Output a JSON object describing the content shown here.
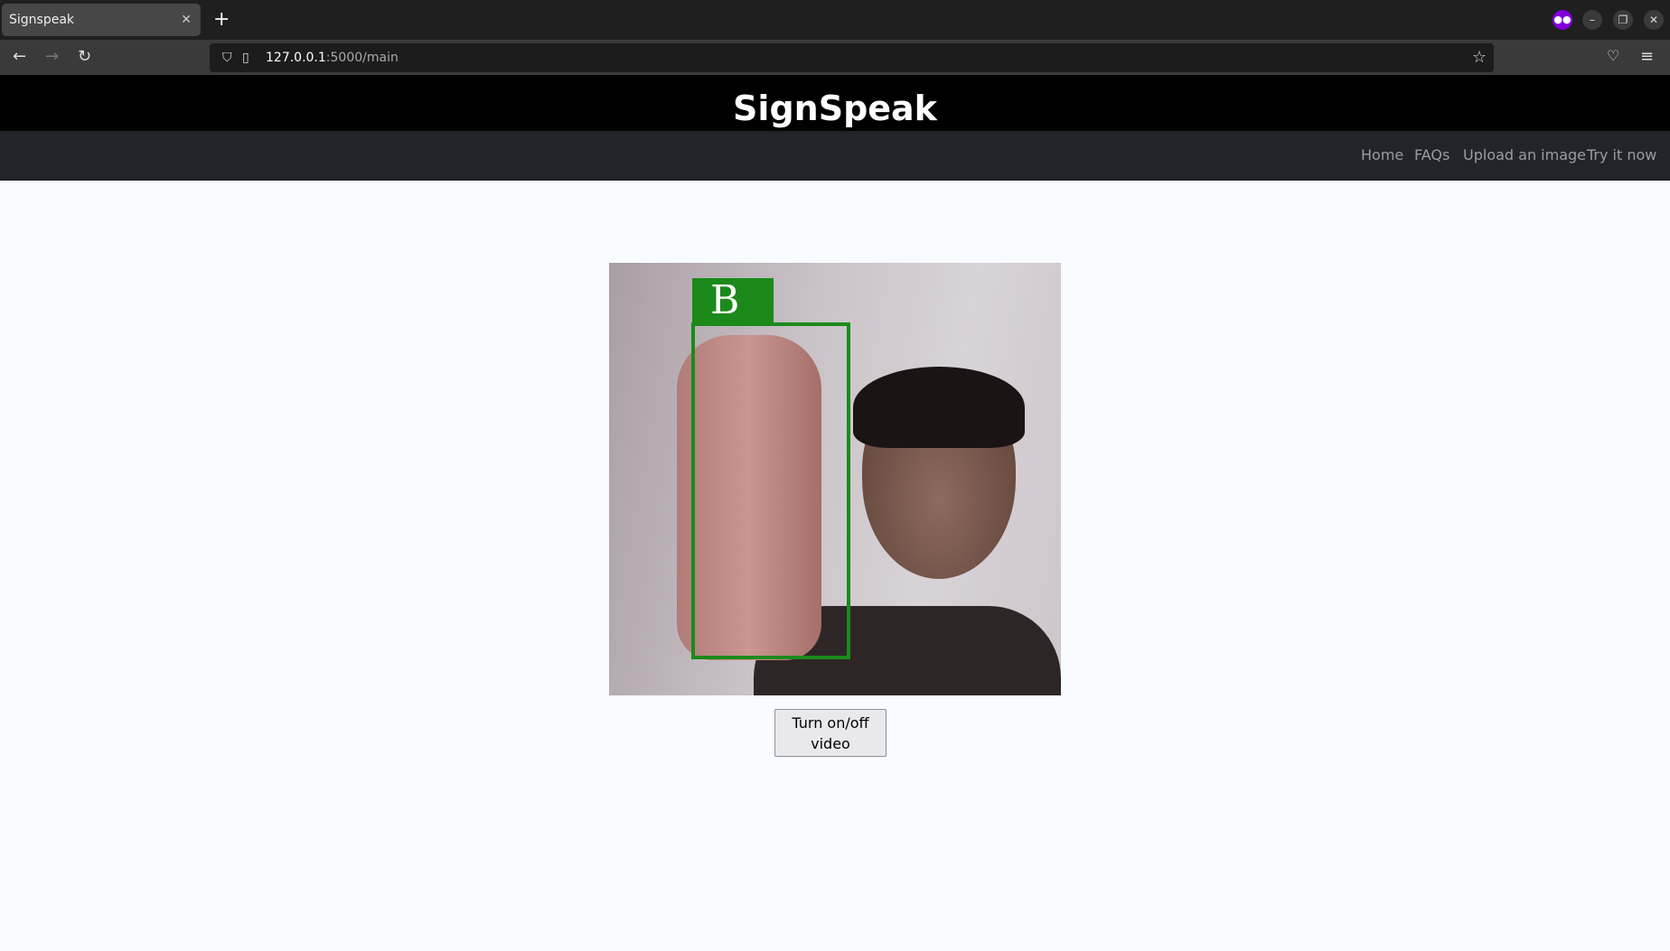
{
  "browser": {
    "tab_title": "Signspeak",
    "url_host": "127.0.0.1",
    "url_rest": ":5000/main"
  },
  "header": {
    "title": "SignSpeak"
  },
  "nav": {
    "items": [
      "Home",
      "FAQs",
      "Upload an image",
      "Try it now"
    ]
  },
  "video": {
    "detected_label": "B",
    "box_color": "#1b8a1b"
  },
  "controls": {
    "toggle_label": "Turn on/off video"
  }
}
